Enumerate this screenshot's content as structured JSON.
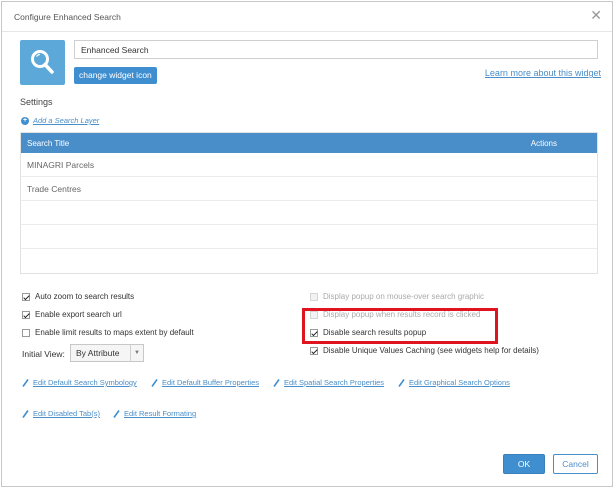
{
  "dialog": {
    "title": "Configure Enhanced Search",
    "close_icon": "close-icon"
  },
  "widget": {
    "icon": "search-icon",
    "icon_color": "#5ba8d9",
    "name_value": "Enhanced Search",
    "change_icon_label": "change widget icon",
    "learn_more_label": "Learn more about this widget"
  },
  "settings": {
    "label": "Settings",
    "add_layer_label": "Add a Search Layer"
  },
  "table": {
    "headers": [
      "Search Title",
      "Actions"
    ],
    "rows": [
      "MINAGRI Parcels",
      "Trade Centres",
      "",
      "",
      ""
    ],
    "header_color": "#4a8ec9"
  },
  "options_left": [
    {
      "label": "Auto zoom to search results",
      "checked": true,
      "disabled": false
    },
    {
      "label": "Enable export search url",
      "checked": true,
      "disabled": false
    },
    {
      "label": "Enable limit results to maps extent by default",
      "checked": false,
      "disabled": false
    }
  ],
  "options_right": [
    {
      "label": "Display popup on mouse-over search graphic",
      "checked": false,
      "disabled": true
    },
    {
      "label": "Display popup when results record is clicked",
      "checked": false,
      "disabled": true
    },
    {
      "label": "Disable search results popup",
      "checked": true,
      "disabled": false
    },
    {
      "label": "Disable Unique Values Caching (see widgets help for details)",
      "checked": true,
      "disabled": false
    }
  ],
  "initial_view": {
    "label": "Initial View:",
    "selected": "By Attribute"
  },
  "links": [
    "Edit Default Search Symbology",
    "Edit Default Buffer Properties",
    "Edit Spatial Search Properties",
    "Edit Graphical Search Options",
    "Edit Disabled Tab(s)",
    "Edit Result Formating"
  ],
  "highlight_color": "#e0141e",
  "footer": {
    "ok_label": "OK",
    "cancel_label": "Cancel"
  }
}
